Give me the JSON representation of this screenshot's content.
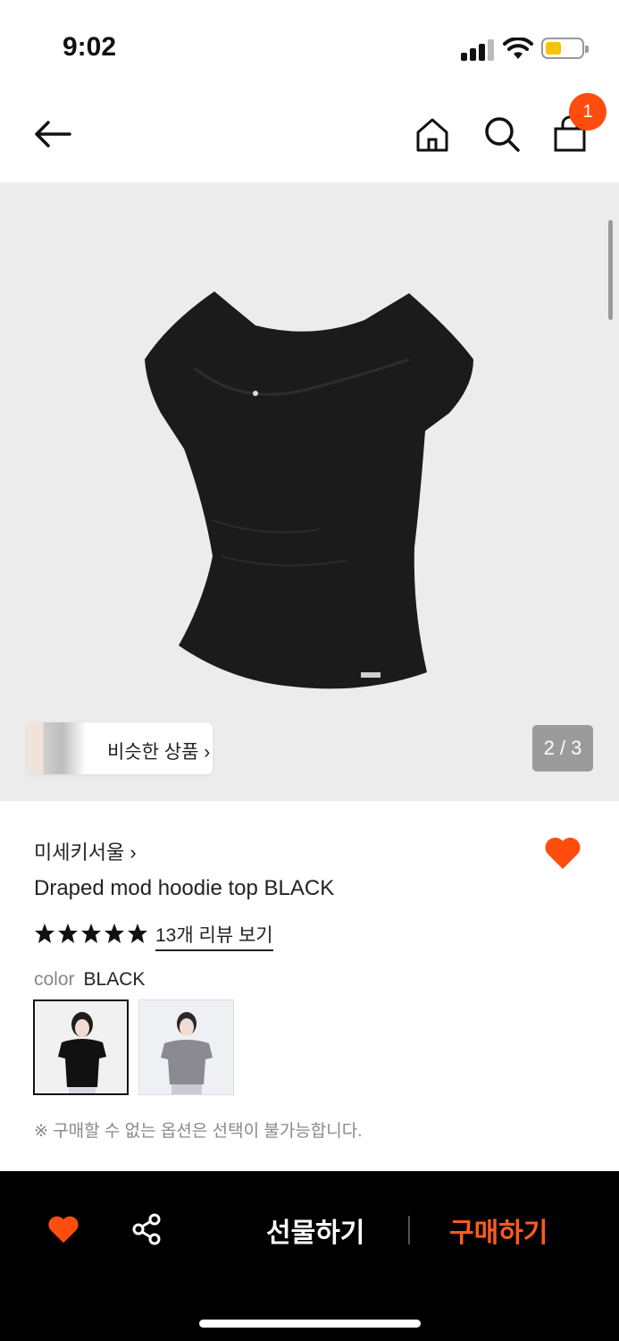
{
  "status_bar": {
    "time": "9:02"
  },
  "nav": {
    "cart_count": "1"
  },
  "gallery": {
    "similar_label": "비슷한 상품",
    "page_indicator": "2 / 3"
  },
  "product": {
    "brand": "미세키서울",
    "brand_chevron": "›",
    "title": "Draped mod hoodie top BLACK",
    "rating_stars": 5,
    "reviews_link": "13개 리뷰 보기",
    "color_label": "color",
    "color_value": "BLACK",
    "swatches": [
      "BLACK",
      "GRAY"
    ],
    "notice": "※ 구매할 수 없는 옵션은 선택이 불가능합니다."
  },
  "bottom_bar": {
    "gift_label": "선물하기",
    "buy_label": "구매하기"
  },
  "colors": {
    "accent": "#ff4d0d",
    "bottom_bg": "#000000",
    "hero_bg": "#ececec"
  }
}
